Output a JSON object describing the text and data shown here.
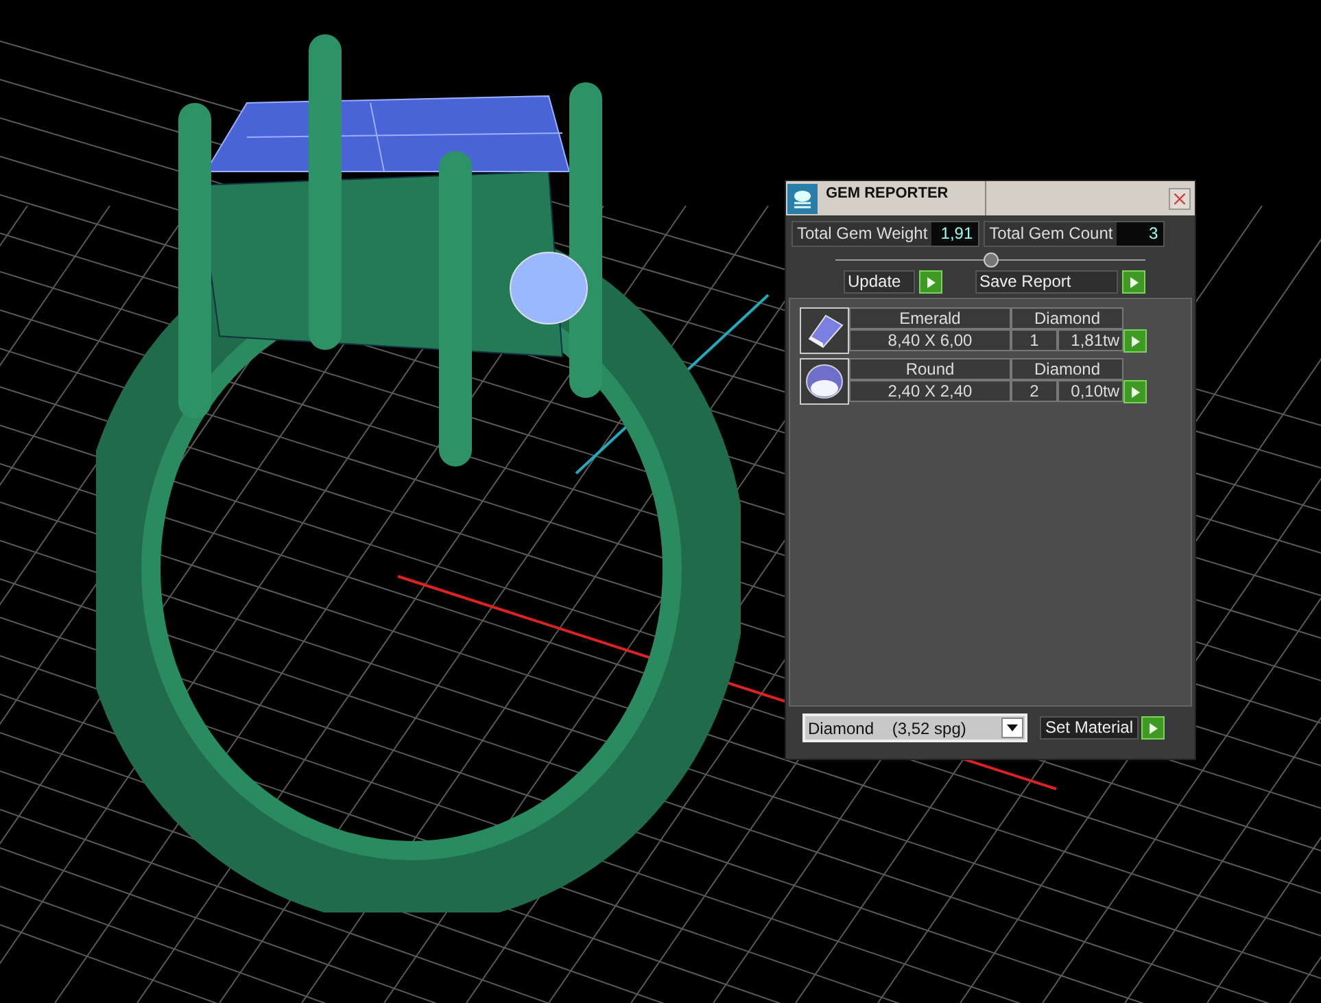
{
  "window": {
    "title": "GEM REPORTER"
  },
  "totals": [
    {
      "label": "Total Gem Weight",
      "value": "1,91"
    },
    {
      "label": "Total Gem Count",
      "value": "3"
    }
  ],
  "actions": [
    "Update",
    "Save Report"
  ],
  "gems": [
    {
      "kind": "emerald",
      "shape": "Emerald",
      "material": "Diamond",
      "size": "8,40 X 6,00",
      "count": "1",
      "weight": "1,81tw"
    },
    {
      "kind": "round",
      "shape": "Round",
      "material": "Diamond",
      "size": "2,40 X 2,40",
      "count": "2",
      "weight": "0,10tw"
    }
  ],
  "material_select": {
    "value": "Diamond    (3,52 spg)"
  },
  "set_material": "Set Material"
}
